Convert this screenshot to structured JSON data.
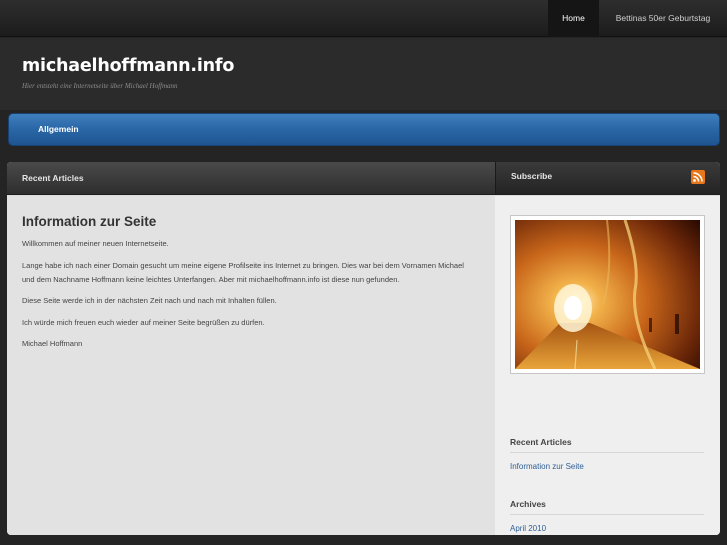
{
  "top_nav": {
    "home": "Home",
    "bettina": "Bettinas 50er Geburtstag"
  },
  "header": {
    "title": "michaelhoffmann.info",
    "tagline": "Hier entsteht eine Internetseite über Michael Hoffmann"
  },
  "category_bar": {
    "item": "Allgemein"
  },
  "main": {
    "heading": "Recent Articles",
    "post": {
      "title": "Information zur Seite",
      "paragraphs": [
        "Willkommen auf meiner neuen Internetseite.",
        "Lange habe ich nach einer Domain gesucht um meine eigene Profilseite ins Internet zu bringen. Dies war bei dem Vornamen Michael und dem Nachname Hoffmann keine leichtes Unterfangen. Aber mit michaelhoffmann.info ist diese nun gefunden.",
        "Diese Seite werde ich in der nächsten Zeit nach und nach mit Inhalten füllen.",
        "Ich würde mich freuen euch wieder auf meiner Seite begrüßen zu dürfen.",
        "Michael Hoffmann"
      ]
    }
  },
  "sidebar": {
    "subscribe": "Subscribe",
    "rss_icon": "rss-feed-icon",
    "recent_title": "Recent Articles",
    "recent_link": "Information zur Seite",
    "archives_title": "Archives",
    "archive_link": "April 2010"
  },
  "colors": {
    "accent_blue": "#2b68a8",
    "rss_orange": "#e8761b",
    "link": "#2d5f95"
  }
}
